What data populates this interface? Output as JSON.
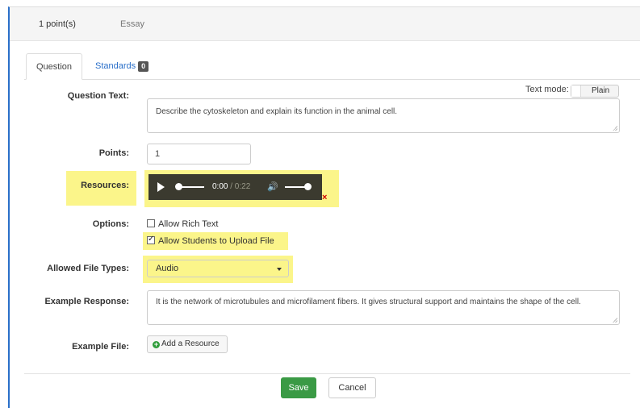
{
  "header": {
    "points": "1 point(s)",
    "question_type": "Essay"
  },
  "tabs": {
    "question": "Question",
    "standards": "Standards",
    "standards_count": "0"
  },
  "text_mode": {
    "label": "Text mode:",
    "value": "Plain"
  },
  "labels": {
    "question_text": "Question Text:",
    "points": "Points:",
    "resources": "Resources:",
    "options": "Options:",
    "allowed_file_types": "Allowed File Types:",
    "example_response": "Example Response:",
    "example_file": "Example File:"
  },
  "question_text": "Describe the cytoskeleton and explain its function in the animal cell.",
  "points_value": "1",
  "audio": {
    "current": "0:00",
    "duration": "/ 0:22",
    "remove": "×"
  },
  "options": [
    {
      "label": "Allow Rich Text",
      "checked": false
    },
    {
      "label": "Allow Students to Upload File",
      "checked": true
    }
  ],
  "allowed_file_type": "Audio",
  "example_response": "It is the network of microtubules and microfilament fibers. It gives structural support and maintains the shape of the cell.",
  "add_resource": "Add a Resource",
  "buttons": {
    "save": "Save",
    "cancel": "Cancel"
  },
  "colors": {
    "highlight": "#fbf58a",
    "accent": "#2a6fc9",
    "save": "#3a9a45",
    "remove": "#cc0000"
  }
}
